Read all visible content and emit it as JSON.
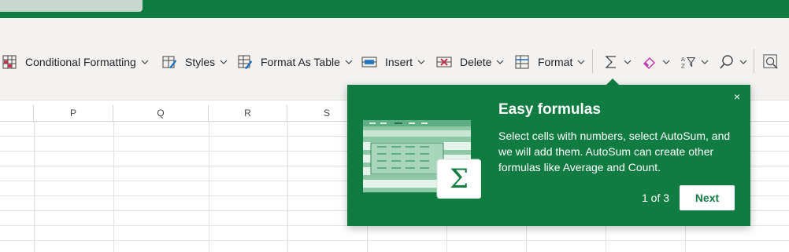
{
  "ribbon": {
    "items": [
      {
        "label": "Conditional Formatting",
        "icon": "conditional-formatting-icon"
      },
      {
        "label": "Styles",
        "icon": "styles-icon"
      },
      {
        "label": "Format As Table",
        "icon": "format-as-table-icon"
      },
      {
        "label": "Insert",
        "icon": "insert-cells-icon"
      },
      {
        "label": "Delete",
        "icon": "delete-cells-icon"
      },
      {
        "label": "Format",
        "icon": "format-cells-icon"
      }
    ],
    "icon_buttons": [
      "autosum-icon",
      "clear-eraser-icon",
      "sort-filter-icon",
      "find-search-icon",
      "analyze-data-icon"
    ]
  },
  "grid": {
    "columns": [
      "P",
      "Q",
      "R",
      "S"
    ]
  },
  "callout": {
    "title": "Easy formulas",
    "body": "Select cells with numbers, select AutoSum, and we will add them. AutoSum can create other formulas like Average and Count.",
    "counter": "1 of 3",
    "next_label": "Next",
    "close_glyph": "×",
    "sigma_glyph": "Σ"
  },
  "colors": {
    "brand": "#107c41",
    "ribbon_bg": "#f3f2f1",
    "accent_pink": "#c239b3"
  }
}
